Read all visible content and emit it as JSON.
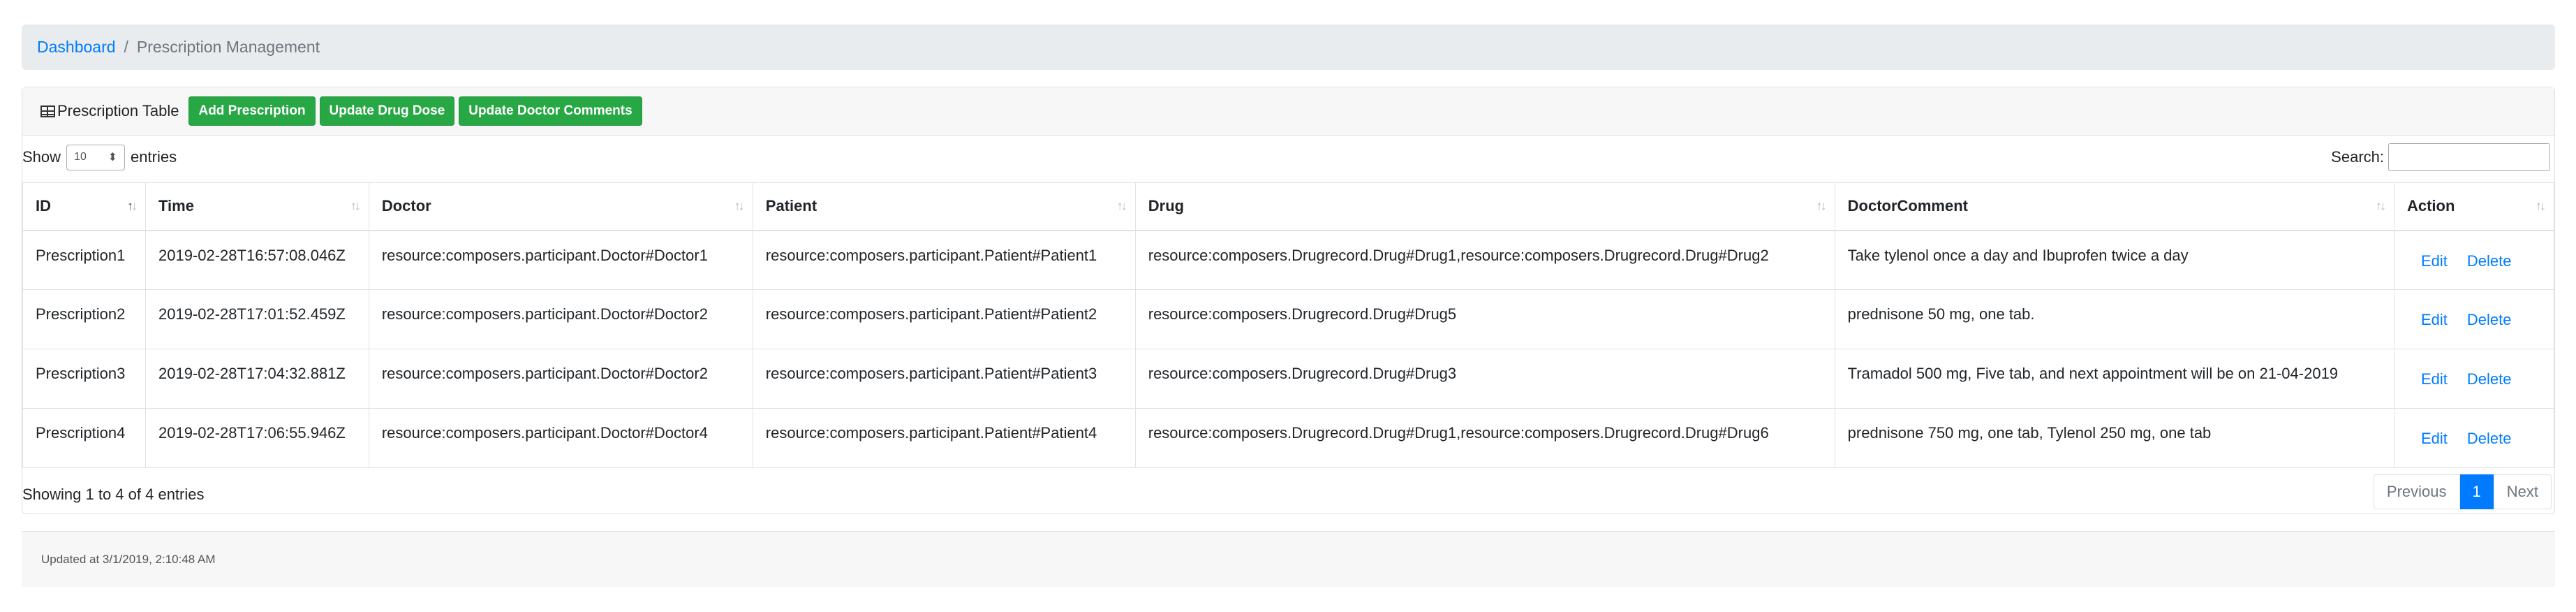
{
  "breadcrumb": {
    "home": "Dashboard",
    "separator": "/",
    "current": "Prescription Management"
  },
  "card": {
    "title": "Prescription Table",
    "buttons": {
      "add": "Add Prescription",
      "update_dose": "Update Drug Dose",
      "update_comments": "Update Doctor Comments"
    }
  },
  "controls": {
    "show_label": "Show",
    "length_value": "10",
    "entries_label": "entries",
    "search_label": "Search:",
    "search_value": ""
  },
  "table": {
    "headers": [
      "ID",
      "Time",
      "Doctor",
      "Patient",
      "Drug",
      "DoctorComment",
      "Action"
    ],
    "rows": [
      {
        "id": "Prescription1",
        "time": "2019-02-28T16:57:08.046Z",
        "doctor": "resource:composers.participant.Doctor#Doctor1",
        "patient": "resource:composers.participant.Patient#Patient1",
        "drug": "resource:composers.Drugrecord.Drug#Drug1,resource:composers.Drugrecord.Drug#Drug2",
        "comment": "Take tylenol once a day and Ibuprofen twice a day",
        "edit": "Edit",
        "delete": "Delete"
      },
      {
        "id": "Prescription2",
        "time": "2019-02-28T17:01:52.459Z",
        "doctor": "resource:composers.participant.Doctor#Doctor2",
        "patient": "resource:composers.participant.Patient#Patient2",
        "drug": "resource:composers.Drugrecord.Drug#Drug5",
        "comment": "prednisone 50 mg, one tab.",
        "edit": "Edit",
        "delete": "Delete"
      },
      {
        "id": "Prescription3",
        "time": "2019-02-28T17:04:32.881Z",
        "doctor": "resource:composers.participant.Doctor#Doctor2",
        "patient": "resource:composers.participant.Patient#Patient3",
        "drug": "resource:composers.Drugrecord.Drug#Drug3",
        "comment": "Tramadol 500 mg, Five tab, and next appointment will be on 21-04-2019",
        "edit": "Edit",
        "delete": "Delete"
      },
      {
        "id": "Prescription4",
        "time": "2019-02-28T17:06:55.946Z",
        "doctor": "resource:composers.participant.Doctor#Doctor4",
        "patient": "resource:composers.participant.Patient#Patient4",
        "drug": "resource:composers.Drugrecord.Drug#Drug1,resource:composers.Drugrecord.Drug#Drug6",
        "comment": "prednisone 750 mg, one tab, Tylenol 250 mg, one tab",
        "edit": "Edit",
        "delete": "Delete"
      }
    ]
  },
  "info": "Showing 1 to 4 of 4 entries",
  "pagination": {
    "previous": "Previous",
    "current": "1",
    "next": "Next"
  },
  "footer": {
    "updated": "Updated at 3/1/2019, 2:10:48 AM"
  },
  "icons": {
    "table": "table-icon",
    "sort": "sort-arrows-icon",
    "select_caret": "select-caret-icon"
  },
  "colors": {
    "primary": "#007bff",
    "success": "#28a745"
  }
}
